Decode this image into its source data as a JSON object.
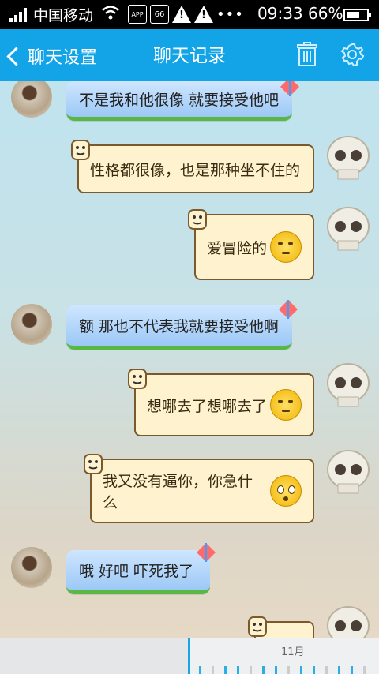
{
  "status_bar": {
    "carrier": "中国移动",
    "notif_app_label": "APP",
    "notif_count": "66",
    "more": "•••",
    "time": "09:33",
    "battery": "66%",
    "battery_level": 0.66
  },
  "header": {
    "back_label": "聊天设置",
    "title": "聊天记录"
  },
  "messages": [
    {
      "side": "left",
      "text": "不是我和他很像 就要接受他吧"
    },
    {
      "side": "right",
      "text": "性格都很像，也是那种坐不住的"
    },
    {
      "side": "right",
      "text": "爱冒险的",
      "emoji": "relieved-emoji"
    },
    {
      "side": "left",
      "text": "额 那也不代表我就要接受他啊"
    },
    {
      "side": "right",
      "text": "想哪去了想哪去了",
      "emoji": "unamused-emoji"
    },
    {
      "side": "right",
      "text": "我又没有逼你，你急什么",
      "emoji": "flushed-emoji"
    },
    {
      "side": "left",
      "text": "哦 好吧 吓死我了"
    }
  ],
  "timeline": {
    "month_label": "11月"
  },
  "colors": {
    "accent": "#13a4e8",
    "left_bubble": "#9cc8f6",
    "left_bubble_underline": "#59b844",
    "right_bubble": "#fff3cf"
  }
}
